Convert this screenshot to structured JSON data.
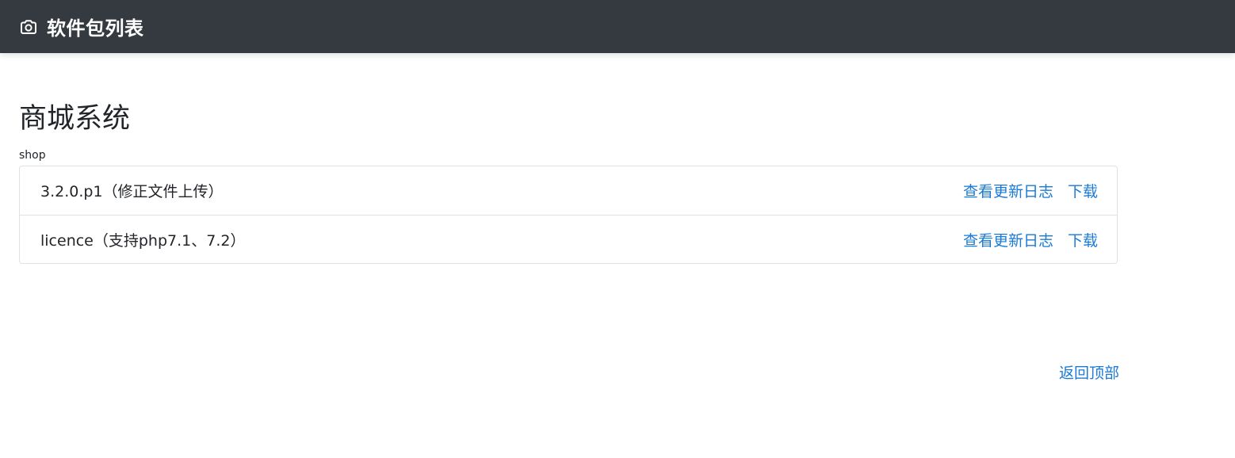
{
  "header": {
    "title": "软件包列表",
    "icon": "camera-icon"
  },
  "section": {
    "title": "商城系统",
    "subtitle": "shop",
    "packages": [
      {
        "name": "3.2.0.p1（修正文件上传）",
        "changelog_label": "查看更新日志",
        "download_label": "下载"
      },
      {
        "name": "licence（支持php7.1、7.2）",
        "changelog_label": "查看更新日志",
        "download_label": "下载"
      }
    ]
  },
  "footer": {
    "back_to_top_label": "返回顶部"
  },
  "colors": {
    "navbar": "#343a40",
    "link": "#1a7ad4",
    "border": "#dee2e6"
  }
}
